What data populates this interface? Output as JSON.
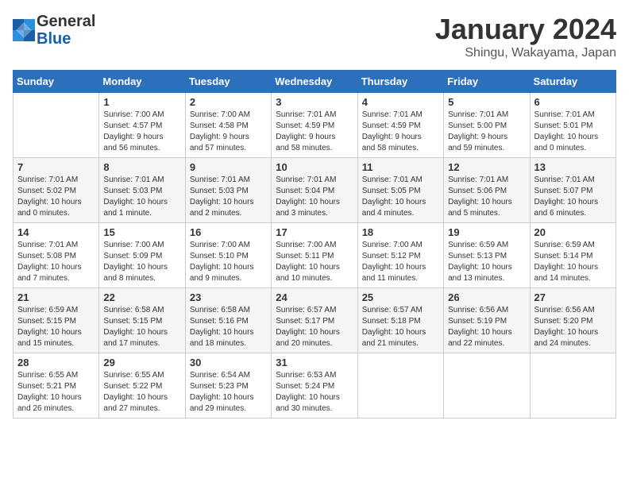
{
  "header": {
    "logo_line1": "General",
    "logo_line2": "Blue",
    "month_title": "January 2024",
    "subtitle": "Shingu, Wakayama, Japan"
  },
  "weekdays": [
    "Sunday",
    "Monday",
    "Tuesday",
    "Wednesday",
    "Thursday",
    "Friday",
    "Saturday"
  ],
  "weeks": [
    [
      {
        "day": "",
        "info": ""
      },
      {
        "day": "1",
        "info": "Sunrise: 7:00 AM\nSunset: 4:57 PM\nDaylight: 9 hours\nand 56 minutes."
      },
      {
        "day": "2",
        "info": "Sunrise: 7:00 AM\nSunset: 4:58 PM\nDaylight: 9 hours\nand 57 minutes."
      },
      {
        "day": "3",
        "info": "Sunrise: 7:01 AM\nSunset: 4:59 PM\nDaylight: 9 hours\nand 58 minutes."
      },
      {
        "day": "4",
        "info": "Sunrise: 7:01 AM\nSunset: 4:59 PM\nDaylight: 9 hours\nand 58 minutes."
      },
      {
        "day": "5",
        "info": "Sunrise: 7:01 AM\nSunset: 5:00 PM\nDaylight: 9 hours\nand 59 minutes."
      },
      {
        "day": "6",
        "info": "Sunrise: 7:01 AM\nSunset: 5:01 PM\nDaylight: 10 hours\nand 0 minutes."
      }
    ],
    [
      {
        "day": "7",
        "info": "Sunrise: 7:01 AM\nSunset: 5:02 PM\nDaylight: 10 hours\nand 0 minutes."
      },
      {
        "day": "8",
        "info": "Sunrise: 7:01 AM\nSunset: 5:03 PM\nDaylight: 10 hours\nand 1 minute."
      },
      {
        "day": "9",
        "info": "Sunrise: 7:01 AM\nSunset: 5:03 PM\nDaylight: 10 hours\nand 2 minutes."
      },
      {
        "day": "10",
        "info": "Sunrise: 7:01 AM\nSunset: 5:04 PM\nDaylight: 10 hours\nand 3 minutes."
      },
      {
        "day": "11",
        "info": "Sunrise: 7:01 AM\nSunset: 5:05 PM\nDaylight: 10 hours\nand 4 minutes."
      },
      {
        "day": "12",
        "info": "Sunrise: 7:01 AM\nSunset: 5:06 PM\nDaylight: 10 hours\nand 5 minutes."
      },
      {
        "day": "13",
        "info": "Sunrise: 7:01 AM\nSunset: 5:07 PM\nDaylight: 10 hours\nand 6 minutes."
      }
    ],
    [
      {
        "day": "14",
        "info": "Sunrise: 7:01 AM\nSunset: 5:08 PM\nDaylight: 10 hours\nand 7 minutes."
      },
      {
        "day": "15",
        "info": "Sunrise: 7:00 AM\nSunset: 5:09 PM\nDaylight: 10 hours\nand 8 minutes."
      },
      {
        "day": "16",
        "info": "Sunrise: 7:00 AM\nSunset: 5:10 PM\nDaylight: 10 hours\nand 9 minutes."
      },
      {
        "day": "17",
        "info": "Sunrise: 7:00 AM\nSunset: 5:11 PM\nDaylight: 10 hours\nand 10 minutes."
      },
      {
        "day": "18",
        "info": "Sunrise: 7:00 AM\nSunset: 5:12 PM\nDaylight: 10 hours\nand 11 minutes."
      },
      {
        "day": "19",
        "info": "Sunrise: 6:59 AM\nSunset: 5:13 PM\nDaylight: 10 hours\nand 13 minutes."
      },
      {
        "day": "20",
        "info": "Sunrise: 6:59 AM\nSunset: 5:14 PM\nDaylight: 10 hours\nand 14 minutes."
      }
    ],
    [
      {
        "day": "21",
        "info": "Sunrise: 6:59 AM\nSunset: 5:15 PM\nDaylight: 10 hours\nand 15 minutes."
      },
      {
        "day": "22",
        "info": "Sunrise: 6:58 AM\nSunset: 5:15 PM\nDaylight: 10 hours\nand 17 minutes."
      },
      {
        "day": "23",
        "info": "Sunrise: 6:58 AM\nSunset: 5:16 PM\nDaylight: 10 hours\nand 18 minutes."
      },
      {
        "day": "24",
        "info": "Sunrise: 6:57 AM\nSunset: 5:17 PM\nDaylight: 10 hours\nand 20 minutes."
      },
      {
        "day": "25",
        "info": "Sunrise: 6:57 AM\nSunset: 5:18 PM\nDaylight: 10 hours\nand 21 minutes."
      },
      {
        "day": "26",
        "info": "Sunrise: 6:56 AM\nSunset: 5:19 PM\nDaylight: 10 hours\nand 22 minutes."
      },
      {
        "day": "27",
        "info": "Sunrise: 6:56 AM\nSunset: 5:20 PM\nDaylight: 10 hours\nand 24 minutes."
      }
    ],
    [
      {
        "day": "28",
        "info": "Sunrise: 6:55 AM\nSunset: 5:21 PM\nDaylight: 10 hours\nand 26 minutes."
      },
      {
        "day": "29",
        "info": "Sunrise: 6:55 AM\nSunset: 5:22 PM\nDaylight: 10 hours\nand 27 minutes."
      },
      {
        "day": "30",
        "info": "Sunrise: 6:54 AM\nSunset: 5:23 PM\nDaylight: 10 hours\nand 29 minutes."
      },
      {
        "day": "31",
        "info": "Sunrise: 6:53 AM\nSunset: 5:24 PM\nDaylight: 10 hours\nand 30 minutes."
      },
      {
        "day": "",
        "info": ""
      },
      {
        "day": "",
        "info": ""
      },
      {
        "day": "",
        "info": ""
      }
    ]
  ]
}
